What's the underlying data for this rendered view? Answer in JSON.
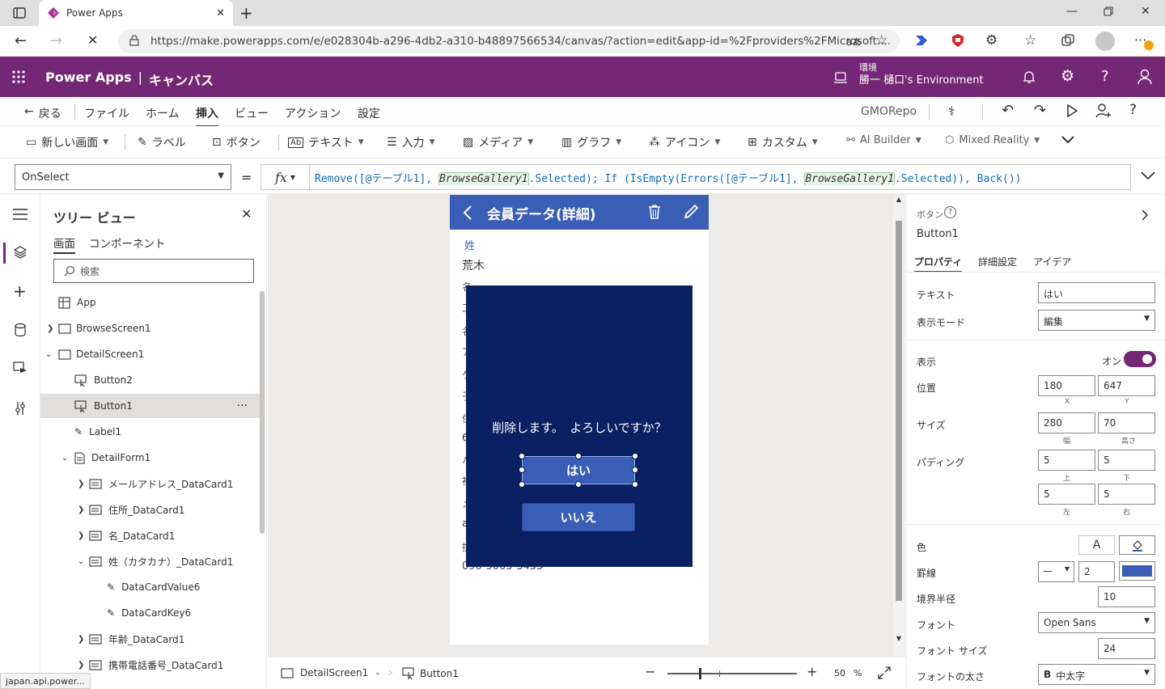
{
  "browser": {
    "tab_title": "Power Apps",
    "url": "https://make.powerapps.com/e/e028304b-a296-4db2-a310-b48897566534/canvas/?action=edit&app-id=%2Fproviders%2FMicrosoft....",
    "status_url": "japan.api.power..."
  },
  "header": {
    "product": "Power Apps",
    "separator": "|",
    "mode": "キャンバス",
    "env_label": "環境",
    "env_name": "勝一 樋口's Environment"
  },
  "menu": {
    "back": "戻る",
    "items": [
      "ファイル",
      "ホーム",
      "挿入",
      "ビュー",
      "アクション",
      "設定"
    ],
    "app_name": "GMORepo"
  },
  "commands": {
    "new_screen": "新しい画面",
    "label": "ラベル",
    "button": "ボタン",
    "text": "テキスト",
    "input": "入力",
    "media": "メディア",
    "graph": "グラフ",
    "icon": "アイコン",
    "custom": "カスタム",
    "ai_builder": "AI Builder",
    "mixed_reality": "Mixed Reality"
  },
  "formula": {
    "property": "OnSelect",
    "equals": "=",
    "fx": "fx",
    "p1": "Remove([@テーブル1], ",
    "g1": "BrowseGallery1",
    "p2": ".Selected); If (IsEmpty(Errors([@テーブル1], ",
    "g2": "BrowseGallery1",
    "p3": ".Selected)), Back())"
  },
  "tree": {
    "title": "ツリー ビュー",
    "tab_screens": "画面",
    "tab_components": "コンポーネント",
    "search_placeholder": "検索",
    "more": "···",
    "nodes": [
      "App",
      "BrowseScreen1",
      "DetailScreen1",
      "Button2",
      "Button1",
      "Label1",
      "DetailForm1",
      "メールアドレス_DataCard1",
      "住所_DataCard1",
      "名_DataCard1",
      "姓（カタカナ）_DataCard1",
      "DataCardValue6",
      "DataCardKey6",
      "年齢_DataCard1",
      "携帯電話番号_DataCard1"
    ]
  },
  "app_screen": {
    "title": "会員データ(詳細)",
    "field_label": "姓",
    "field_value": "荒木",
    "partial_chars": [
      "名",
      "工",
      "名",
      "ア",
      "ケ",
      "子",
      "住",
      "6",
      "ハ",
      "神",
      "メ",
      "a",
      "携"
    ],
    "phone": "090-9005-3455",
    "dialog_message": "削除します。　よろしいですか？",
    "yes": "はい",
    "no": "いいえ"
  },
  "statusbar": {
    "screen": "DetailScreen1",
    "control": "Button1",
    "zoom_value": 50,
    "zoom_unit": "%"
  },
  "properties": {
    "category": "ボタン",
    "control_name": "Button1",
    "tabs": [
      "プロパティ",
      "詳細設定",
      "アイデア"
    ],
    "text_label": "テキスト",
    "text_value": "はい",
    "display_mode_label": "表示モード",
    "display_mode_value": "編集",
    "visible_label": "表示",
    "visible_state": "オン",
    "position_label": "位置",
    "x": "180",
    "y": "647",
    "x_label": "X",
    "y_label": "Y",
    "size_label": "サイズ",
    "width": "280",
    "height": "70",
    "width_label": "幅",
    "height_label": "高さ",
    "padding_label": "パディング",
    "pad_top": "5",
    "pad_bottom": "5",
    "pad_left": "5",
    "pad_right": "5",
    "pad_top_label": "上",
    "pad_bottom_label": "下",
    "pad_left_label": "左",
    "pad_right_label": "右",
    "color_label": "色",
    "font_color_glyph": "A",
    "border_label": "罫線",
    "border_style": "—",
    "border_width": "2",
    "border_color": "#3a5eb5",
    "radius_label": "境界半径",
    "radius": "10",
    "font_label": "フォント",
    "font_value": "Open Sans",
    "font_size_label": "フォント サイズ",
    "font_size": "24",
    "font_weight_label": "フォントの太さ",
    "font_weight_glyph": "B",
    "font_weight_value": "中太字"
  },
  "colors": {
    "header": "#742774",
    "screen_header": "#3a5eb5",
    "dialog": "#0b1f63",
    "button": "#3a5eb5",
    "toggle": "#742774"
  }
}
